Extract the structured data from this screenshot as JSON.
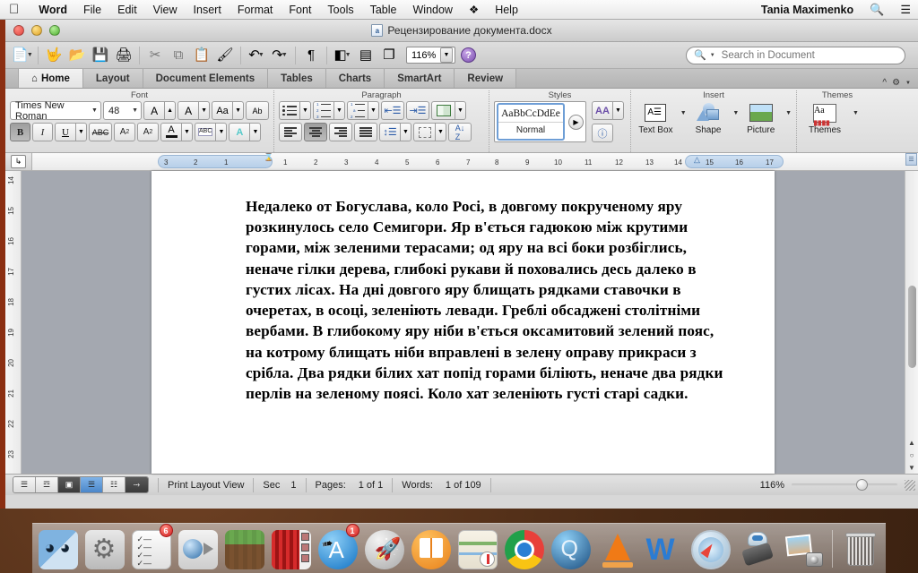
{
  "menubar": {
    "apple": "apple-logo",
    "items": [
      "Word",
      "File",
      "Edit",
      "View",
      "Insert",
      "Format",
      "Font",
      "Tools",
      "Table",
      "Window"
    ],
    "dropbox_icon": "dropbox-icon",
    "help": "Help",
    "user": "Tania Maximenko",
    "search_icon": "search-icon",
    "list_icon": "list-icon"
  },
  "window": {
    "title": "Рецензирование документа.docx",
    "doc_icon_letter": "a"
  },
  "toolbar": {
    "buttons": [
      {
        "name": "new-document-button",
        "glyph": "📄",
        "has_arrow": true
      },
      {
        "name": "gallery-button",
        "glyph": "🪟",
        "has_arrow": false
      },
      {
        "name": "open-button",
        "glyph": "📂",
        "has_arrow": false
      },
      {
        "name": "save-button",
        "glyph": "💾",
        "has_arrow": false
      },
      {
        "name": "print-button",
        "glyph": "🖨",
        "has_arrow": false
      },
      {
        "name": "cut-button",
        "glyph": "✂",
        "has_arrow": false
      },
      {
        "name": "copy-button",
        "glyph": "⧉",
        "has_arrow": false
      },
      {
        "name": "paste-button",
        "glyph": "📋",
        "has_arrow": false
      },
      {
        "name": "format-painter-button",
        "glyph": "🖌",
        "has_arrow": false
      },
      {
        "name": "undo-button",
        "glyph": "↶",
        "has_arrow": true
      },
      {
        "name": "redo-button",
        "glyph": "↷",
        "has_arrow": true
      },
      {
        "name": "show-formatting-button",
        "glyph": "¶",
        "has_arrow": false
      },
      {
        "name": "sidebar-button",
        "glyph": "◧",
        "has_arrow": true
      },
      {
        "name": "notebook-layout-button",
        "glyph": "▤",
        "has_arrow": false
      },
      {
        "name": "media-browser-button",
        "glyph": "❐",
        "has_arrow": false
      }
    ],
    "zoom_value": "116%",
    "help_label": "?"
  },
  "search": {
    "placeholder": "Search in Document",
    "value": ""
  },
  "tabs": {
    "items": [
      "Home",
      "Layout",
      "Document Elements",
      "Tables",
      "Charts",
      "SmartArt",
      "Review"
    ],
    "active": "Home",
    "home_icon": "home-icon",
    "collapse_icon": "chevron-up-icon",
    "settings_icon": "gear-icon"
  },
  "ribbon": {
    "groups": [
      {
        "label": "Font"
      },
      {
        "label": "Paragraph"
      },
      {
        "label": "Styles"
      },
      {
        "label": "Insert"
      },
      {
        "label": "Themes"
      }
    ],
    "font": {
      "name": "Times New Roman",
      "size": "48",
      "grow_label": "A",
      "shrink_label": "A",
      "case_label": "Aa",
      "clear_label": "Ab",
      "bold": "B",
      "italic": "I",
      "underline": "U",
      "strikethrough": "ABC",
      "superscript": "A",
      "subscript": "A",
      "font_color": "A",
      "highlight": "ABC",
      "text_effects": "A",
      "bold_active": true
    },
    "paragraph": {
      "bullets": "bulleted-list",
      "numbering": "numbered-list",
      "multilevel": "multilevel-list",
      "indent_decrease": "decrease-indent",
      "indent_increase": "increase-indent",
      "columns": "columns",
      "align_left": "align-left",
      "align_center": "align-center",
      "align_right": "align-right",
      "align_justify": "align-justify",
      "line_spacing": "line-spacing",
      "borders": "borders",
      "sort": "sort-az",
      "active_align": "align-center"
    },
    "styles": {
      "preview_text": "AaBbCcDdEe",
      "style_name": "Normal",
      "gallery_arrow": "▶",
      "manage_styles": "manage-styles",
      "style_info": "style-info"
    },
    "insert": {
      "items": [
        {
          "label": "Text Box",
          "icon": "text-box-icon"
        },
        {
          "label": "Shape",
          "icon": "shape-icon"
        },
        {
          "label": "Picture",
          "icon": "picture-icon"
        }
      ]
    },
    "themes": {
      "items": [
        {
          "label": "Themes",
          "icon": "themes-icon"
        }
      ]
    }
  },
  "ruler": {
    "tab_selector": "left-tab-stop",
    "horizontal_left_ticks": [
      "3",
      "2",
      "1"
    ],
    "horizontal_right_ticks": [
      "1",
      "2",
      "3",
      "4",
      "5",
      "6",
      "7",
      "8",
      "9",
      "10",
      "11",
      "12",
      "13",
      "14",
      "15",
      "16",
      "17"
    ],
    "vertical_ticks": [
      "14",
      "15",
      "16",
      "17",
      "18",
      "19",
      "20",
      "21",
      "22",
      "23"
    ],
    "left_indent_marker": "left-indent-marker",
    "right_indent_marker": "right-indent-marker"
  },
  "document": {
    "paragraph": "Недалеко от Богуслава, коло Росі, в довгому покрученому яру розкинулось село Семигори. Яр в'ється гадюкою між крутими горами, між зеленими терасами; од яру на всі боки розбіглись, неначе гілки дерева, глибокі рукави й поховались десь далеко в густих лісах. На дні довгого яру блищать рядками ставочки в очеретах, в осоці, зеленіють левади. Греблі обсаджені столітніми вербами. В глибокому яру ніби в'ється оксамитовий зелений пояс, на котрому блищать ніби вправлені в зелену оправу прикраси з срібла. Два рядки білих хат попід горами біліють, неначе два рядки перлів на зеленому поясі. Коло хат зеленіють густі старі садки."
  },
  "status": {
    "view_buttons": [
      {
        "name": "draft-view-button",
        "icon": "☰"
      },
      {
        "name": "outline-view-button",
        "icon": "☲"
      },
      {
        "name": "publishing-view-button",
        "icon": "▣"
      },
      {
        "name": "print-layout-view-button",
        "icon": "☰"
      },
      {
        "name": "notebook-view-button",
        "icon": "☷"
      },
      {
        "name": "full-screen-view-button",
        "icon": "⤡"
      }
    ],
    "active_view_index": 3,
    "view_label": "Print Layout View",
    "sec_label": "Sec",
    "sec_value": "1",
    "pages_label": "Pages:",
    "pages_value": "1 of 1",
    "words_label": "Words:",
    "words_value": "1 of 109",
    "zoom_value": "116%"
  },
  "dock": {
    "items": [
      {
        "name": "finder",
        "badge": null
      },
      {
        "name": "system-preferences",
        "badge": null
      },
      {
        "name": "reminders",
        "badge": "6"
      },
      {
        "name": "facetime",
        "badge": null
      },
      {
        "name": "minecraft",
        "badge": null
      },
      {
        "name": "photo-booth",
        "badge": null
      },
      {
        "name": "app-store",
        "badge": "1"
      },
      {
        "name": "launchpad",
        "badge": null
      },
      {
        "name": "ibooks",
        "badge": null
      },
      {
        "name": "maps",
        "badge": null
      },
      {
        "name": "chrome",
        "badge": null
      },
      {
        "name": "quicktime",
        "badge": null
      },
      {
        "name": "vlc",
        "badge": null
      },
      {
        "name": "word",
        "badge": null
      },
      {
        "name": "safari",
        "badge": null
      },
      {
        "name": "automator",
        "badge": null
      },
      {
        "name": "iphoto",
        "badge": null
      },
      {
        "name": "trash",
        "badge": null
      }
    ]
  },
  "colors": {
    "accent": "#4a86c9",
    "word_red": "#8b2f12",
    "ruler_blue": "#b7cfe9"
  }
}
